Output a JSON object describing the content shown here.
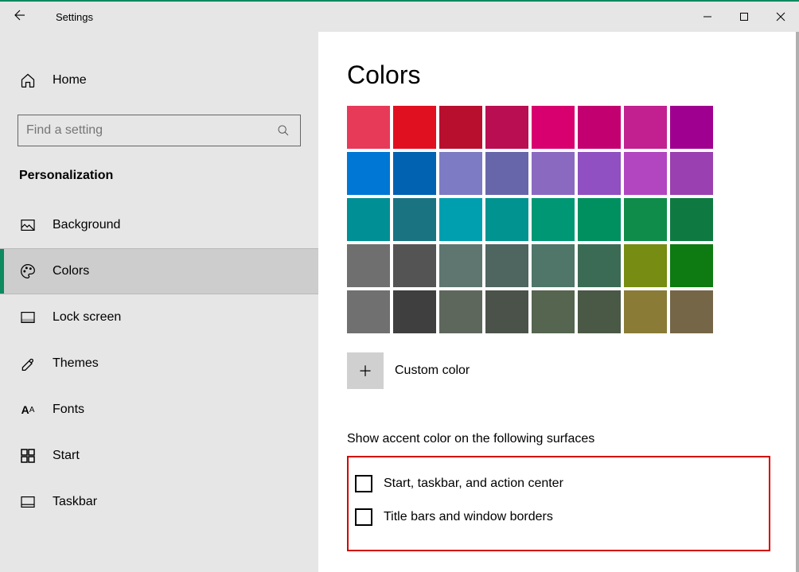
{
  "window": {
    "title": "Settings"
  },
  "sidebar": {
    "home": "Home",
    "search_placeholder": "Find a setting",
    "section": "Personalization",
    "items": [
      {
        "label": "Background"
      },
      {
        "label": "Colors"
      },
      {
        "label": "Lock screen"
      },
      {
        "label": "Themes"
      },
      {
        "label": "Fonts"
      },
      {
        "label": "Start"
      },
      {
        "label": "Taskbar"
      }
    ]
  },
  "main": {
    "title": "Colors",
    "swatches": [
      [
        "#e73a59",
        "#e11020",
        "#b90f2f",
        "#b90e52",
        "#d8006f",
        "#c20070",
        "#c22091",
        "#a0008f"
      ],
      [
        "#0077d4",
        "#0062b0",
        "#7d7bc3",
        "#6866ab",
        "#8a6ac1",
        "#9050c1",
        "#b246c1",
        "#9b40b0"
      ],
      [
        "#008f94",
        "#1a7380",
        "#009fb0",
        "#00938f",
        "#009775",
        "#009060",
        "#0f8c4a",
        "#0e7a42"
      ],
      [
        "#6f6f6f",
        "#545454",
        "#5e766f",
        "#4f655f",
        "#4f7668",
        "#3c6b55",
        "#768c12",
        "#0e7a12"
      ],
      [
        "#707070",
        "#3f3f3f",
        "#5e675c",
        "#4b524a",
        "#556550",
        "#4a5946",
        "#8a7b36",
        "#756648"
      ]
    ],
    "custom_label": "Custom color",
    "accent_header": "Show accent color on the following surfaces",
    "checks": [
      "Start, taskbar, and action center",
      "Title bars and window borders"
    ]
  }
}
